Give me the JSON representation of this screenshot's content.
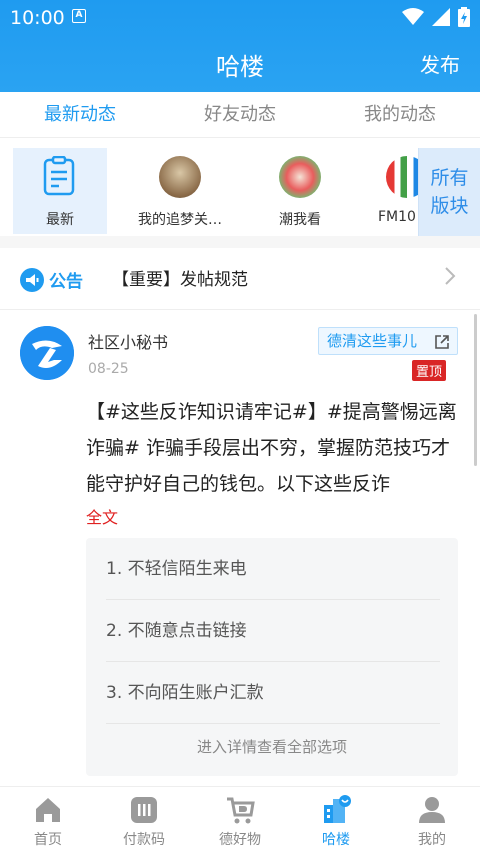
{
  "status_bar": {
    "time": "10:00",
    "app_badge": "A"
  },
  "header": {
    "title": "哈楼",
    "publish_label": "发布"
  },
  "tabs": [
    {
      "label": "最新动态",
      "active": true
    },
    {
      "label": "好友动态",
      "active": false
    },
    {
      "label": "我的动态",
      "active": false
    }
  ],
  "boards": [
    {
      "label": "最新",
      "icon": "notepad-icon"
    },
    {
      "label": "我的追梦关…",
      "icon": "board-thumbnail"
    },
    {
      "label": "潮我看",
      "icon": "board-thumbnail"
    },
    {
      "label": "FM10",
      "icon": "board-thumbnail"
    }
  ],
  "all_boards_label": "所有\n版块",
  "notice": {
    "badge_label": "公告",
    "text": "【重要】发帖规范"
  },
  "post": {
    "author": "社区小秘书",
    "date": "08-25",
    "board_tag": "德清这些事儿",
    "pin_label": "置顶",
    "content": "【#这些反诈知识请牢记#】#提高警惕远离诈骗# 诈骗手段层出不穷，掌握防范技巧才能守护好自己的钱包。以下这些反诈",
    "full_text_label": "全文",
    "poll_options": [
      "1. 不轻信陌生来电",
      "2. 不随意点击链接",
      "3. 不向陌生账户汇款"
    ],
    "poll_more_label": "进入详情查看全部选项"
  },
  "bottom_nav": [
    {
      "label": "首页",
      "icon": "home-icon",
      "active": false
    },
    {
      "label": "付款码",
      "icon": "payment-code-icon",
      "active": false
    },
    {
      "label": "德好物",
      "icon": "shopping-cart-icon",
      "active": false
    },
    {
      "label": "哈楼",
      "icon": "community-icon",
      "active": true
    },
    {
      "label": "我的",
      "icon": "profile-icon",
      "active": false
    }
  ],
  "colors": {
    "primary": "#1f9bf0",
    "pin": "#d92626",
    "fulltext": "#e02020"
  }
}
